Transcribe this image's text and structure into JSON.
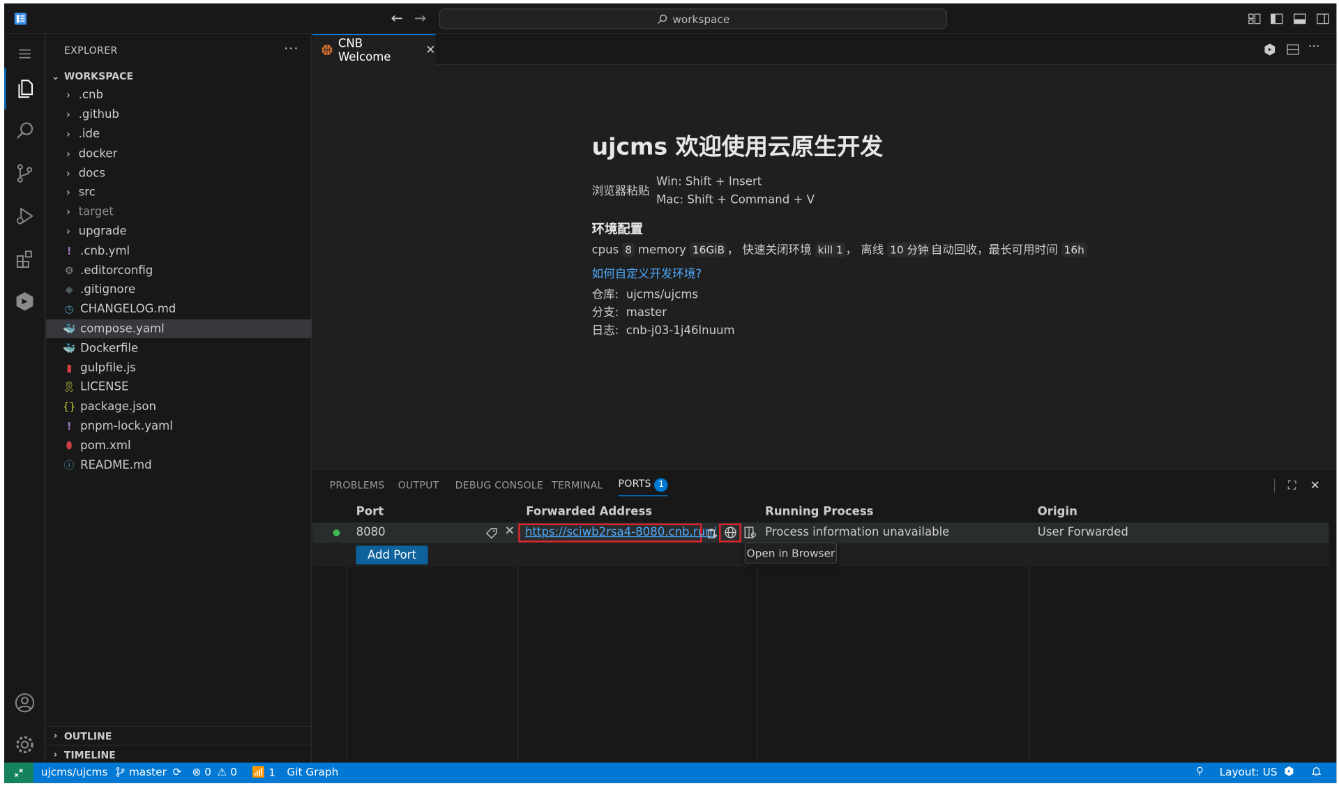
{
  "titlebar": {
    "search_text": "workspace"
  },
  "sidebar": {
    "title": "EXPLORER",
    "more": "···",
    "workspace": "WORKSPACE",
    "folders": [
      ".cnb",
      ".github",
      ".ide",
      "docker",
      "docs",
      "src",
      "target",
      "upgrade"
    ],
    "files": [
      ".cnb.yml",
      ".editorconfig",
      ".gitignore",
      "CHANGELOG.md",
      "compose.yaml",
      "Dockerfile",
      "gulpfile.js",
      "LICENSE",
      "package.json",
      "pnpm-lock.yaml",
      "pom.xml",
      "README.md"
    ],
    "outline": "OUTLINE",
    "timeline": "TIMELINE"
  },
  "editor": {
    "tab_label": "CNB Welcome",
    "welcome": {
      "title": "ujcms 欢迎使用云原生开发",
      "paste_label": "浏览器粘贴",
      "paste_win": "Win: Shift + Insert",
      "paste_mac": "Mac: Shift + Command + V",
      "env_heading": "环境配置",
      "env_cpus_label": "cpus",
      "env_cpus": "8",
      "env_memory_label": "memory",
      "env_memory": "16GiB",
      "env_close_label": "， 快速关闭环境",
      "env_kill": "kill 1",
      "env_offline_label": "， 离线",
      "env_offline": "10 分钟",
      "env_recycle_label": "自动回收，最长可用时间",
      "env_max": "16h",
      "custom_link": "如何自定义开发环境?",
      "repo_label": "仓库:",
      "repo": "ujcms/ujcms",
      "branch_label": "分支:",
      "branch": "master",
      "log_label": "日志:",
      "log": "cnb-j03-1j46lnuum"
    }
  },
  "panel": {
    "tabs": [
      "PROBLEMS",
      "OUTPUT",
      "DEBUG CONSOLE",
      "TERMINAL",
      "PORTS"
    ],
    "ports_count": "1",
    "columns": [
      "Port",
      "Forwarded Address",
      "Running Process",
      "Origin"
    ],
    "row": {
      "port": "8080",
      "address": "https://sciwb2rsa4-8080.cnb.run/",
      "process": "Process information unavailable",
      "origin": "User Forwarded"
    },
    "add_port": "Add Port",
    "tooltip": "Open in Browser"
  },
  "statusbar": {
    "repo": "ujcms/ujcms",
    "branch": "master",
    "errors": "0",
    "warnings": "0",
    "ports": "1",
    "git_graph": "Git Graph",
    "layout": "Layout: US"
  },
  "colors": {
    "accent": "#0078d4",
    "highlight_box": "#e0242b",
    "remote": "#16825d"
  }
}
